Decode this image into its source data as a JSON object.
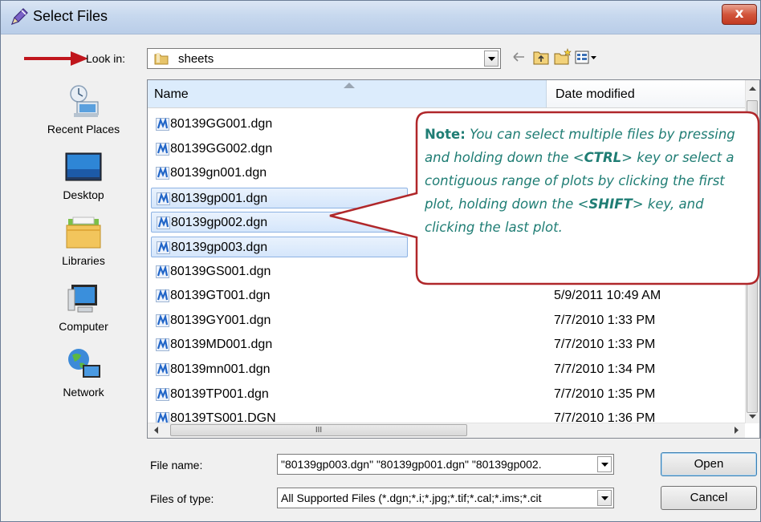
{
  "title": "Select Files",
  "close_glyph": "x",
  "look_in": {
    "label": "Look in:",
    "value": "sheets"
  },
  "places": [
    {
      "label": "Recent Places",
      "icon": "recent-places-icon"
    },
    {
      "label": "Desktop",
      "icon": "desktop-icon"
    },
    {
      "label": "Libraries",
      "icon": "libraries-icon"
    },
    {
      "label": "Computer",
      "icon": "computer-icon"
    },
    {
      "label": "Network",
      "icon": "network-icon"
    }
  ],
  "columns": {
    "name": "Name",
    "date": "Date modified"
  },
  "files": [
    {
      "name": "80139GG001.dgn",
      "date": "",
      "selected": false
    },
    {
      "name": "80139GG002.dgn",
      "date": "",
      "selected": false
    },
    {
      "name": "80139gn001.dgn",
      "date": "",
      "selected": false
    },
    {
      "name": "80139gp001.dgn",
      "date": "",
      "selected": true
    },
    {
      "name": "80139gp002.dgn",
      "date": "",
      "selected": true
    },
    {
      "name": "80139gp003.dgn",
      "date": "",
      "selected": true
    },
    {
      "name": "80139GS001.dgn",
      "date": "",
      "selected": false
    },
    {
      "name": "80139GT001.dgn",
      "date": "5/9/2011 10:49 AM",
      "selected": false
    },
    {
      "name": "80139GY001.dgn",
      "date": "7/7/2010 1:33 PM",
      "selected": false
    },
    {
      "name": "80139MD001.dgn",
      "date": "7/7/2010 1:33 PM",
      "selected": false
    },
    {
      "name": "80139mn001.dgn",
      "date": "7/7/2010 1:34 PM",
      "selected": false
    },
    {
      "name": "80139TP001.dgn",
      "date": "7/7/2010 1:35 PM",
      "selected": false
    },
    {
      "name": "80139TS001.DGN",
      "date": "7/7/2010 1:36 PM",
      "selected": false
    }
  ],
  "hscroll_grip": "III",
  "file_name": {
    "label": "File name:",
    "value": "\"80139gp003.dgn\" \"80139gp001.dgn\" \"80139gp002."
  },
  "file_type": {
    "label": "Files of type:",
    "value": "All Supported Files (*.dgn;*.i;*.jpg;*.tif;*.cal;*.ims;*.cit"
  },
  "buttons": {
    "open": "Open",
    "cancel": "Cancel"
  },
  "note": {
    "lead": "Note:",
    "t1": " You can select multiple files by pressing and holding down the <",
    "ctrl": "CTRL",
    "t2": "> key or select a contiguous range of plots by clicking the first plot, holding down the <",
    "shift": "SHIFT",
    "t3": "> key, and clicking the last plot."
  },
  "colors": {
    "note_text": "#1f7d74",
    "callout_border": "#b0272a",
    "arrow": "#c0161d",
    "selection": "#d5e6fb"
  }
}
